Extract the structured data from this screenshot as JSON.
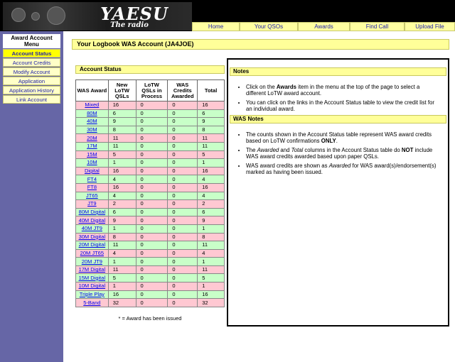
{
  "header": {
    "logo_text": "YAESU",
    "logo_tagline": "The radio",
    "nav": [
      "Home",
      "Your QSOs",
      "Awards",
      "Find Call",
      "Upload File"
    ]
  },
  "sidebar": {
    "title": "Award Account Menu",
    "items": [
      {
        "label": "Account Status",
        "active": true
      },
      {
        "label": "Account Credits",
        "active": false
      },
      {
        "label": "Modify Account",
        "active": false
      },
      {
        "label": "Application",
        "active": false
      },
      {
        "label": "Application History",
        "active": false
      },
      {
        "label": "Link Account",
        "active": false
      }
    ]
  },
  "page_title": "Your Logbook WAS Account (JA4JOE)",
  "account_status": {
    "header": "Account Status",
    "columns": [
      "WAS Award",
      "New LoTW QSLs",
      "LoTW QSLs in Process",
      "WAS Credits Awarded",
      "Total"
    ],
    "rows": [
      {
        "award": "Mixed",
        "new": "16",
        "process": "0",
        "awarded": "0",
        "total": "16",
        "color": "pink"
      },
      {
        "award": "80M",
        "new": "6",
        "process": "0",
        "awarded": "0",
        "total": "6",
        "color": "green"
      },
      {
        "award": "40M",
        "new": "9",
        "process": "0",
        "awarded": "0",
        "total": "9",
        "color": "green"
      },
      {
        "award": "30M",
        "new": "8",
        "process": "0",
        "awarded": "0",
        "total": "8",
        "color": "green"
      },
      {
        "award": "20M",
        "new": "11",
        "process": "0",
        "awarded": "0",
        "total": "11",
        "color": "pink"
      },
      {
        "award": "17M",
        "new": "11",
        "process": "0",
        "awarded": "0",
        "total": "11",
        "color": "green"
      },
      {
        "award": "15M",
        "new": "5",
        "process": "0",
        "awarded": "0",
        "total": "5",
        "color": "pink"
      },
      {
        "award": "10M",
        "new": "1",
        "process": "0",
        "awarded": "0",
        "total": "1",
        "color": "green"
      },
      {
        "award": "Digital",
        "new": "16",
        "process": "0",
        "awarded": "0",
        "total": "16",
        "color": "pink"
      },
      {
        "award": "FT4",
        "new": "4",
        "process": "0",
        "awarded": "0",
        "total": "4",
        "color": "green"
      },
      {
        "award": "FT8",
        "new": "16",
        "process": "0",
        "awarded": "0",
        "total": "16",
        "color": "pink"
      },
      {
        "award": "JT65",
        "new": "4",
        "process": "0",
        "awarded": "0",
        "total": "4",
        "color": "green"
      },
      {
        "award": "JT9",
        "new": "2",
        "process": "0",
        "awarded": "0",
        "total": "2",
        "color": "pink"
      },
      {
        "award": "80M Digital",
        "new": "6",
        "process": "0",
        "awarded": "0",
        "total": "6",
        "color": "green"
      },
      {
        "award": "40M Digital",
        "new": "9",
        "process": "0",
        "awarded": "0",
        "total": "9",
        "color": "pink"
      },
      {
        "award": "40M JT9",
        "new": "1",
        "process": "0",
        "awarded": "0",
        "total": "1",
        "color": "green"
      },
      {
        "award": "30M Digital",
        "new": "8",
        "process": "0",
        "awarded": "0",
        "total": "8",
        "color": "pink"
      },
      {
        "award": "20M Digital",
        "new": "11",
        "process": "0",
        "awarded": "0",
        "total": "11",
        "color": "green"
      },
      {
        "award": "20M JT65",
        "new": "4",
        "process": "0",
        "awarded": "0",
        "total": "4",
        "color": "pink"
      },
      {
        "award": "20M JT9",
        "new": "1",
        "process": "0",
        "awarded": "0",
        "total": "1",
        "color": "green"
      },
      {
        "award": "17M Digital",
        "new": "11",
        "process": "0",
        "awarded": "0",
        "total": "11",
        "color": "pink"
      },
      {
        "award": "15M Digital",
        "new": "5",
        "process": "0",
        "awarded": "0",
        "total": "5",
        "color": "green"
      },
      {
        "award": "10M Digital",
        "new": "1",
        "process": "0",
        "awarded": "0",
        "total": "1",
        "color": "pink"
      },
      {
        "award": "Triple Play",
        "new": "16",
        "process": "0",
        "awarded": "0",
        "total": "16",
        "color": "green"
      },
      {
        "award": "5-Band",
        "new": "32",
        "process": "0",
        "awarded": "0",
        "total": "32",
        "color": "pink"
      }
    ],
    "footnote": "* = Award has been issued"
  },
  "notes": {
    "header": "Notes",
    "items": [
      [
        {
          "t": "Click on the "
        },
        {
          "t": "Awards",
          "b": true
        },
        {
          "t": " item in the menu at the top of the page to select a different LoTW award account."
        }
      ],
      [
        {
          "t": "You can click on the links in the Account Status table to view the credit list for an individual award."
        }
      ]
    ]
  },
  "was_notes": {
    "header": "WAS Notes",
    "items": [
      [
        {
          "t": "The counts shown in the Account Status table represent WAS award credits based on LoTW confirmations "
        },
        {
          "t": "ONLY",
          "b": true
        },
        {
          "t": "."
        }
      ],
      [
        {
          "t": "The "
        },
        {
          "t": "Awarded",
          "i": true
        },
        {
          "t": " and "
        },
        {
          "t": "Total",
          "i": true
        },
        {
          "t": " columns in the Account Status table do "
        },
        {
          "t": "NOT",
          "b": true
        },
        {
          "t": " include WAS award credits awarded based upon paper QSLs."
        }
      ],
      [
        {
          "t": "WAS award credits are shown as "
        },
        {
          "t": "Awarded",
          "i": true
        },
        {
          "t": " for WAS award(s)/endorsement(s) marked as having been issued."
        }
      ]
    ]
  },
  "colors": {
    "nav_bg": "#ffffa0",
    "sidebar_bg": "#6666a6",
    "active_item": "#ffff00",
    "row_pink": "#ffc8d2",
    "row_green": "#c8ffc8",
    "link": "#0000ee"
  }
}
